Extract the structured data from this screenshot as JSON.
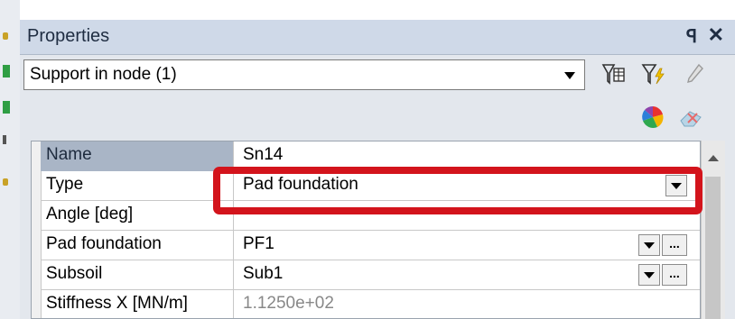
{
  "panel": {
    "title": "Properties",
    "pin_icon": "pin-icon",
    "close_icon": "close-icon"
  },
  "selector": {
    "value": "Support in node (1)"
  },
  "toolbar": {
    "icons": [
      "filter-table-icon",
      "filter-lightning-icon",
      "pencil-icon",
      "color-wheel-icon",
      "eraser-icon"
    ]
  },
  "grid": {
    "rows": [
      {
        "name": "Name",
        "value": "Sn14",
        "selected": true
      },
      {
        "name": "Type",
        "value": "Pad foundation",
        "dropdown": true
      },
      {
        "name": "Angle [deg]",
        "value": ""
      },
      {
        "name": "Pad foundation",
        "value": "PF1",
        "dropdown": true,
        "ellipsis": "..."
      },
      {
        "name": "Subsoil",
        "value": "Sub1",
        "dropdown": true,
        "ellipsis": "..."
      },
      {
        "name": "Stiffness X [MN/m]",
        "value": "1.1250e+02",
        "dim": true
      }
    ]
  },
  "colors": {
    "title_bar": "#cfd9e8",
    "selected_row": "#a9b5c6",
    "highlight": "#d3141c"
  }
}
